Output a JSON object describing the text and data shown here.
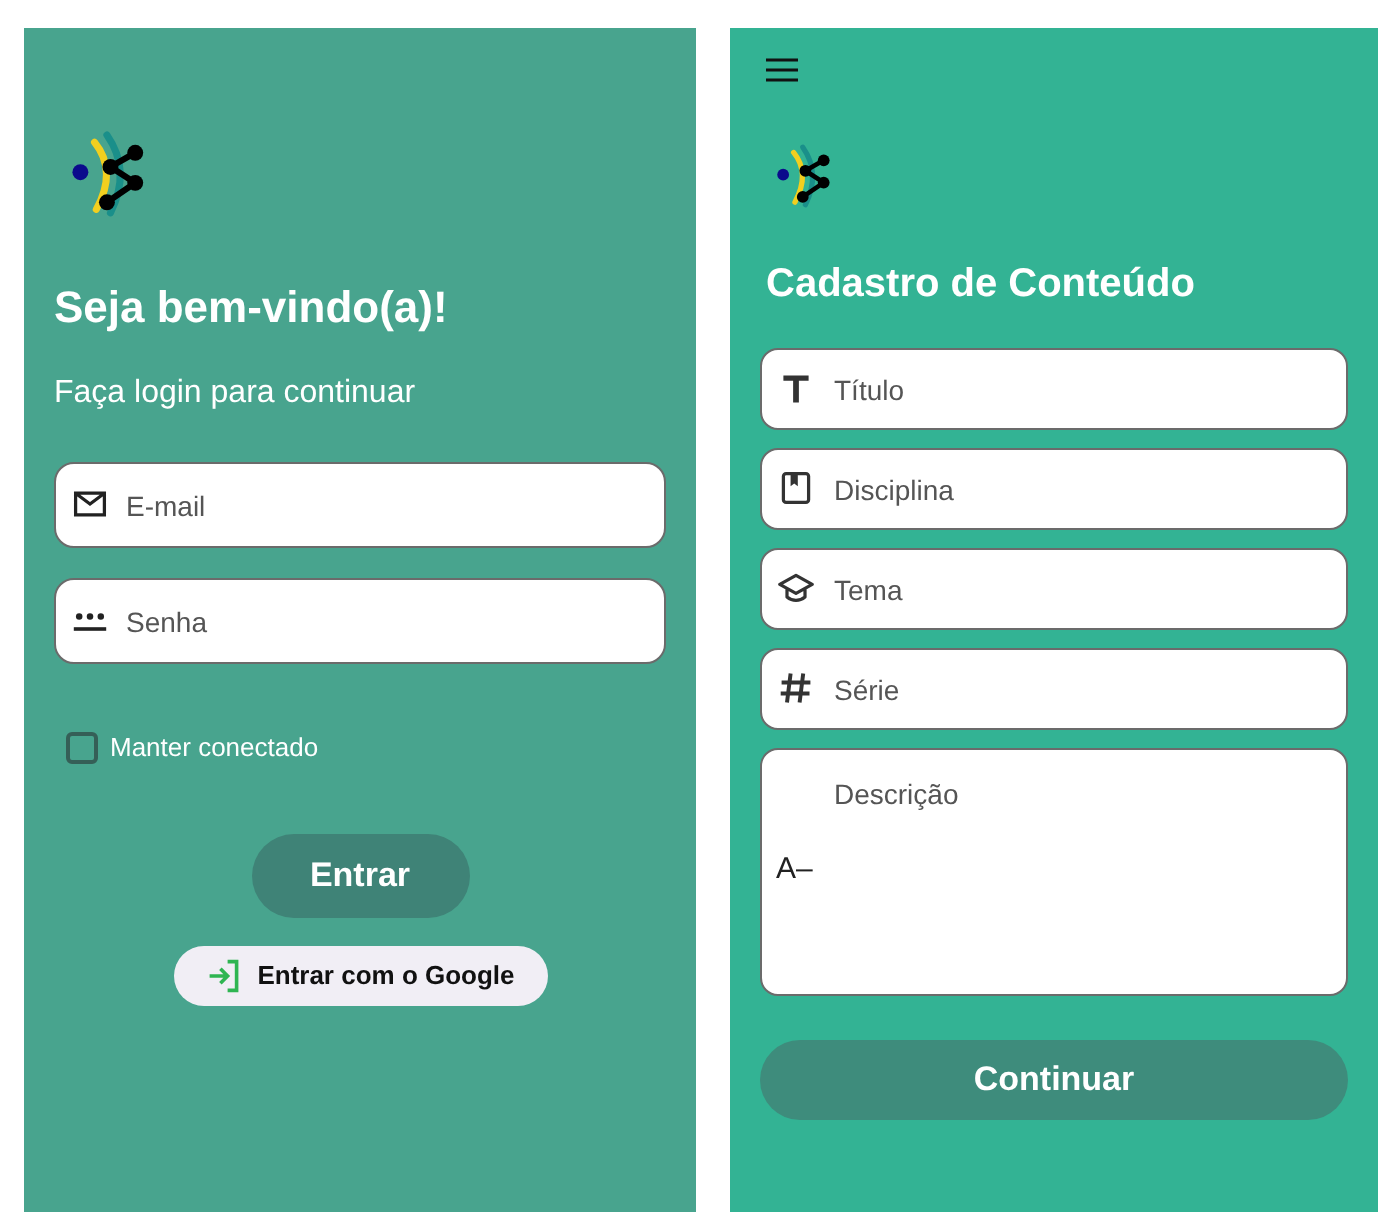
{
  "login": {
    "title": "Seja bem-vindo(a)!",
    "subtitle": "Faça login para continuar",
    "fields": [
      {
        "kind": "email",
        "placeholder": "E-mail"
      },
      {
        "kind": "password",
        "placeholder": "Senha"
      }
    ],
    "remember": {
      "label": "Manter conectado",
      "checked": false
    },
    "submit": "Entrar",
    "google": "Entrar com o Google"
  },
  "content_form": {
    "title": "Cadastro de Conteúdo",
    "fields": [
      {
        "kind": "title",
        "placeholder": "Título"
      },
      {
        "kind": "subject",
        "placeholder": "Disciplina"
      },
      {
        "kind": "theme",
        "placeholder": "Tema"
      },
      {
        "kind": "grade",
        "placeholder": "Série"
      },
      {
        "kind": "description",
        "placeholder": "Descrição",
        "icon_text": "A–"
      }
    ],
    "submit": "Continuar"
  }
}
